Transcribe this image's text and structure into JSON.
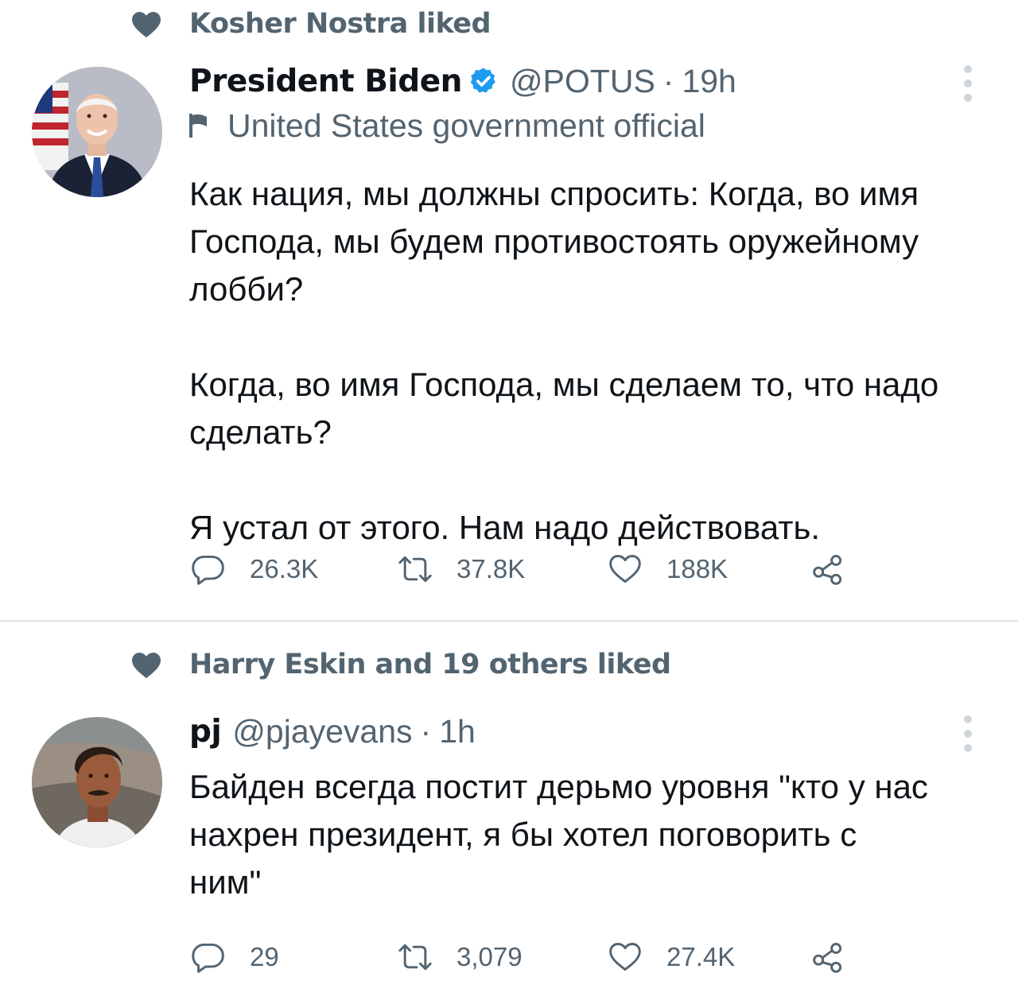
{
  "tweets": [
    {
      "social_context": "Kosher Nostra liked",
      "author_name": "President Biden",
      "handle": "@POTUS",
      "time": "19h",
      "account_label": "United States government official",
      "body": [
        "Как нация, мы должны спросить: Когда, во имя Господа, мы будем противостоять оружейному лобби?",
        "Когда, во имя Господа, мы сделаем то, что надо сделать?",
        "Я устал от этого. Нам надо действовать."
      ],
      "replies": "26.3K",
      "retweets": "37.8K",
      "likes": "188K"
    },
    {
      "social_context": "Harry Eskin and 19 others liked",
      "author_name": "pj",
      "handle": "@pjayevans",
      "time": "1h",
      "body": [
        "Байден всегда постит дерьмо уровня \"кто у нас нахрен президент, я бы хотел поговорить с ним\""
      ],
      "replies": "29",
      "retweets": "3,079",
      "likes": "27.4K"
    }
  ],
  "colors": {
    "text_primary": "#0f1419",
    "text_secondary": "#536471",
    "verified_blue": "#1d9bf0",
    "divider": "#dfe3e6"
  },
  "icons": [
    "heart-icon",
    "verified-badge-icon",
    "flag-icon",
    "reply-icon",
    "retweet-icon",
    "like-icon",
    "share-icon",
    "more-icon"
  ]
}
